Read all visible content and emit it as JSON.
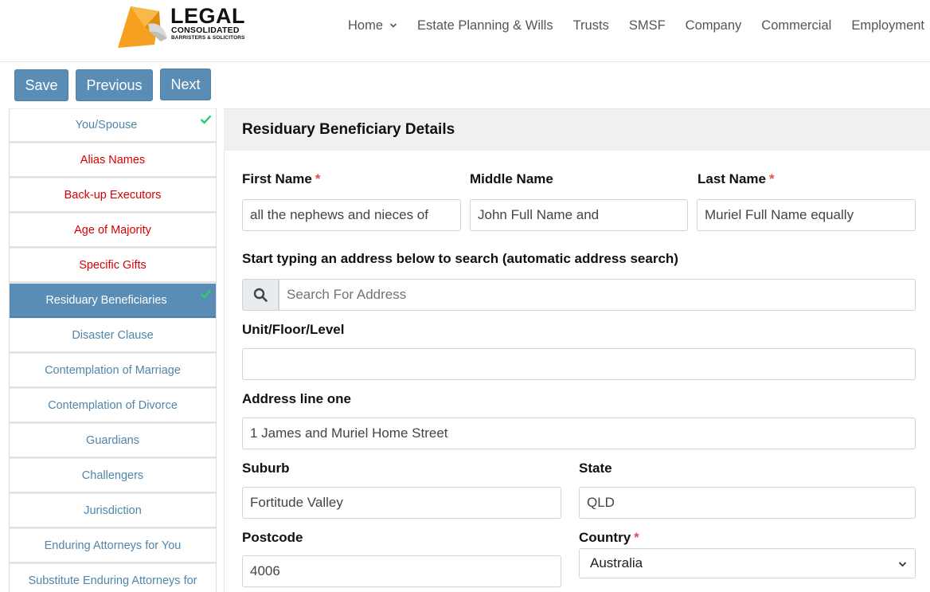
{
  "brand": {
    "title": "LEGAL",
    "subtitle": "CONSOLIDATED",
    "tagline": "BARRISTERS & SOLICITORS",
    "accent": "#f5a020"
  },
  "nav": {
    "items": [
      {
        "label": "Home",
        "icon": "chevron-down-icon"
      },
      {
        "label": "Estate Planning & Wills"
      },
      {
        "label": "Trusts"
      },
      {
        "label": "SMSF"
      },
      {
        "label": "Company"
      },
      {
        "label": "Commercial"
      },
      {
        "label": "Employment"
      }
    ]
  },
  "toolbar": {
    "save": "Save",
    "previous": "Previous",
    "next": "Next"
  },
  "sidebar": {
    "items": [
      {
        "label": "You/Spouse",
        "state": "complete",
        "color": "blue"
      },
      {
        "label": "Alias Names",
        "state": "required",
        "color": "red"
      },
      {
        "label": "Back-up Executors",
        "state": "required",
        "color": "red"
      },
      {
        "label": "Age of Majority",
        "state": "required",
        "color": "red"
      },
      {
        "label": "Specific Gifts",
        "state": "required",
        "color": "red"
      },
      {
        "label": "Residuary Beneficiaries",
        "state": "active-complete"
      },
      {
        "label": "Disaster Clause",
        "color": "blue"
      },
      {
        "label": "Contemplation of Marriage",
        "color": "blue"
      },
      {
        "label": "Contemplation of Divorce",
        "color": "blue"
      },
      {
        "label": "Guardians",
        "color": "blue"
      },
      {
        "label": "Challengers",
        "color": "blue"
      },
      {
        "label": "Jurisdiction",
        "color": "blue"
      },
      {
        "label": "Enduring Attorneys for You",
        "color": "blue"
      },
      {
        "label": "Substitute Enduring Attorneys for",
        "color": "blue"
      }
    ]
  },
  "form": {
    "title": "Residuary Beneficiary Details",
    "first_name": {
      "label": "First Name",
      "required": "*",
      "value": "all the nephews and nieces of"
    },
    "middle_name": {
      "label": "Middle Name",
      "value": "John Full Name and"
    },
    "last_name": {
      "label": "Last Name",
      "required": "*",
      "value": "Muriel Full Name equally"
    },
    "address_search": {
      "label": "Start typing an address below to search (automatic address search)",
      "placeholder": "Search For Address",
      "value": ""
    },
    "unit": {
      "label": "Unit/Floor/Level",
      "value": ""
    },
    "address_line_one": {
      "label": "Address line one",
      "value": "1 James and Muriel Home Street"
    },
    "suburb": {
      "label": "Suburb",
      "value": "Fortitude Valley"
    },
    "state": {
      "label": "State",
      "value": "QLD"
    },
    "postcode": {
      "label": "Postcode",
      "value": "4006"
    },
    "country": {
      "label": "Country",
      "required": "*",
      "value": "Australia"
    }
  },
  "colors": {
    "primary_button": "#5a8db5",
    "required": "#d9534f",
    "complete_check": "#2ecc71",
    "sidebar_link": "#4f86aa",
    "sidebar_error": "#d60000"
  }
}
